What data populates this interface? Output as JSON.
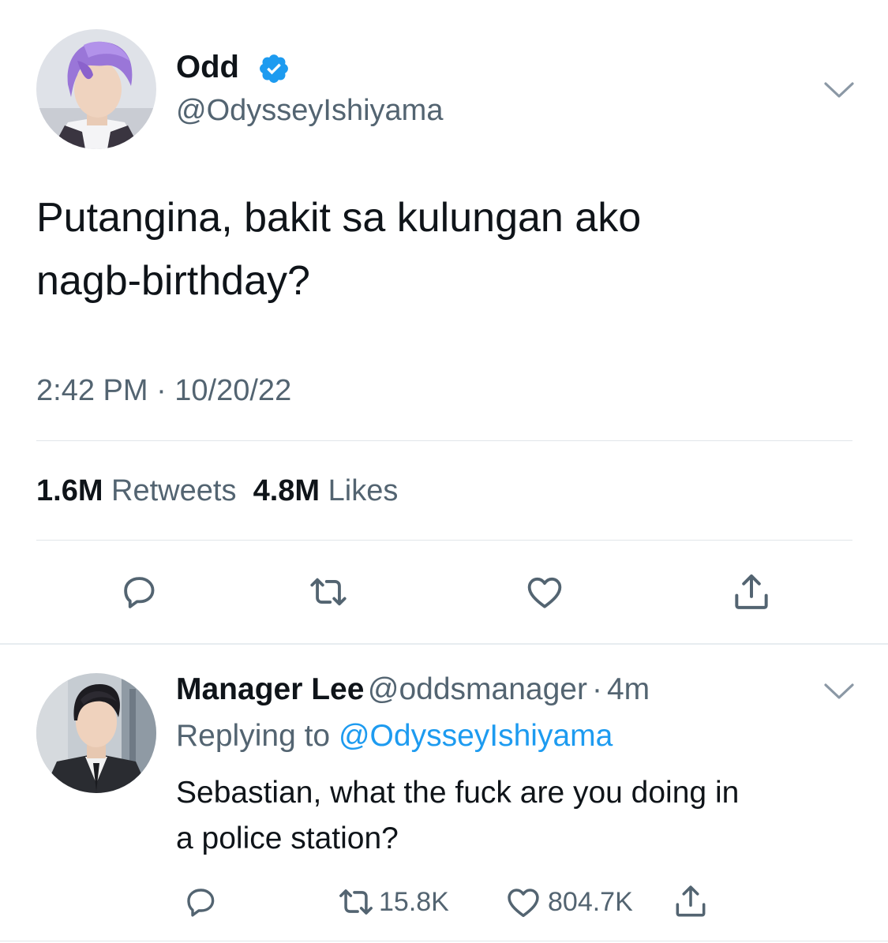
{
  "tweet": {
    "display_name": "Odd",
    "verified": true,
    "handle": "@OdysseyIshiyama",
    "text_line1": "Putangina, bakit sa kulungan ako",
    "text_line2": "nagb-birthday?",
    "timestamp": "2:42 PM · 10/20/22",
    "retweets_count": "1.6M",
    "retweets_label": "Retweets",
    "likes_count": "4.8M",
    "likes_label": "Likes",
    "actions": [
      "reply-icon",
      "retweet-icon",
      "like-icon",
      "share-icon"
    ]
  },
  "reply": {
    "display_name": "Manager Lee",
    "handle": "@oddsmanager",
    "separator": "·",
    "age": "4m",
    "replying_prefix": "Replying to",
    "replying_handle": "@OdysseyIshiyama",
    "text_line1": "Sebastian, what the fuck are you doing in",
    "text_line2": "a police station?",
    "retweet_count": "15.8K",
    "like_count": "804.7K"
  },
  "colors": {
    "text_primary": "#0f1419",
    "text_secondary": "#536471",
    "link": "#1d9bf0",
    "verified_badge": "#1d9bf0",
    "divider": "#e1e6ea"
  }
}
